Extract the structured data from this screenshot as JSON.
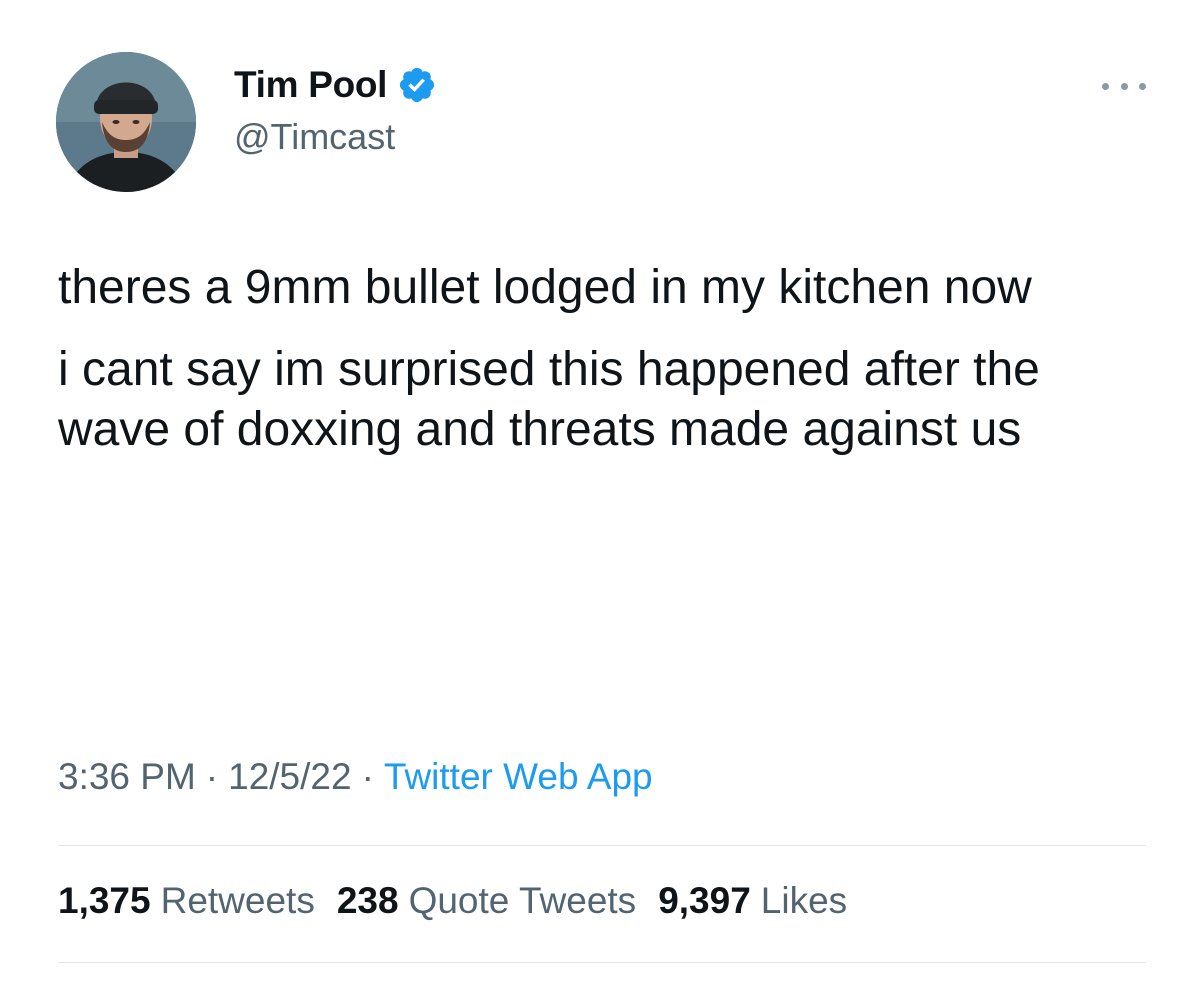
{
  "author": {
    "display_name": "Tim Pool",
    "handle": "@Timcast",
    "verified": true,
    "avatar_icon": "profile-photo"
  },
  "tweet": {
    "paragraphs": [
      "theres a 9mm bullet lodged in my kitchen now",
      "i cant say im surprised this happened after the wave of doxxing and threats made against us"
    ]
  },
  "meta": {
    "time": "3:36 PM",
    "separator": "·",
    "date": "12/5/22",
    "source": "Twitter Web App"
  },
  "stats": {
    "retweets_count": "1,375",
    "retweets_label": "Retweets",
    "quotes_count": "238",
    "quotes_label": "Quote Tweets",
    "likes_count": "9,397",
    "likes_label": "Likes"
  },
  "colors": {
    "text": "#0f1419",
    "secondary": "#536471",
    "accent": "#1d9bf0",
    "divider": "#dfe4e8"
  }
}
